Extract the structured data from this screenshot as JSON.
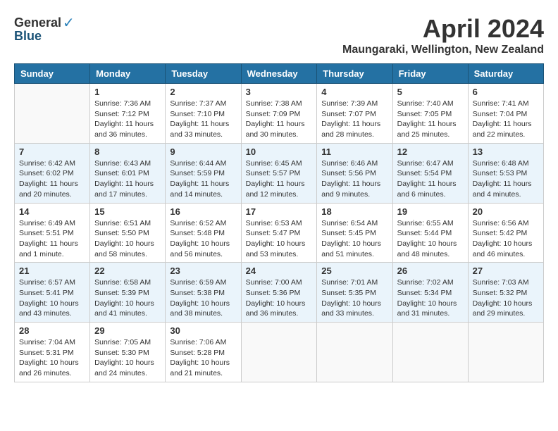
{
  "header": {
    "logo_general": "General",
    "logo_blue": "Blue",
    "month_title": "April 2024",
    "location": "Maungaraki, Wellington, New Zealand"
  },
  "days_of_week": [
    "Sunday",
    "Monday",
    "Tuesday",
    "Wednesday",
    "Thursday",
    "Friday",
    "Saturday"
  ],
  "weeks": [
    [
      {
        "day": "",
        "sunrise": "",
        "sunset": "",
        "daylight": ""
      },
      {
        "day": "1",
        "sunrise": "Sunrise: 7:36 AM",
        "sunset": "Sunset: 7:12 PM",
        "daylight": "Daylight: 11 hours and 36 minutes."
      },
      {
        "day": "2",
        "sunrise": "Sunrise: 7:37 AM",
        "sunset": "Sunset: 7:10 PM",
        "daylight": "Daylight: 11 hours and 33 minutes."
      },
      {
        "day": "3",
        "sunrise": "Sunrise: 7:38 AM",
        "sunset": "Sunset: 7:09 PM",
        "daylight": "Daylight: 11 hours and 30 minutes."
      },
      {
        "day": "4",
        "sunrise": "Sunrise: 7:39 AM",
        "sunset": "Sunset: 7:07 PM",
        "daylight": "Daylight: 11 hours and 28 minutes."
      },
      {
        "day": "5",
        "sunrise": "Sunrise: 7:40 AM",
        "sunset": "Sunset: 7:05 PM",
        "daylight": "Daylight: 11 hours and 25 minutes."
      },
      {
        "day": "6",
        "sunrise": "Sunrise: 7:41 AM",
        "sunset": "Sunset: 7:04 PM",
        "daylight": "Daylight: 11 hours and 22 minutes."
      }
    ],
    [
      {
        "day": "7",
        "sunrise": "Sunrise: 6:42 AM",
        "sunset": "Sunset: 6:02 PM",
        "daylight": "Daylight: 11 hours and 20 minutes."
      },
      {
        "day": "8",
        "sunrise": "Sunrise: 6:43 AM",
        "sunset": "Sunset: 6:01 PM",
        "daylight": "Daylight: 11 hours and 17 minutes."
      },
      {
        "day": "9",
        "sunrise": "Sunrise: 6:44 AM",
        "sunset": "Sunset: 5:59 PM",
        "daylight": "Daylight: 11 hours and 14 minutes."
      },
      {
        "day": "10",
        "sunrise": "Sunrise: 6:45 AM",
        "sunset": "Sunset: 5:57 PM",
        "daylight": "Daylight: 11 hours and 12 minutes."
      },
      {
        "day": "11",
        "sunrise": "Sunrise: 6:46 AM",
        "sunset": "Sunset: 5:56 PM",
        "daylight": "Daylight: 11 hours and 9 minutes."
      },
      {
        "day": "12",
        "sunrise": "Sunrise: 6:47 AM",
        "sunset": "Sunset: 5:54 PM",
        "daylight": "Daylight: 11 hours and 6 minutes."
      },
      {
        "day": "13",
        "sunrise": "Sunrise: 6:48 AM",
        "sunset": "Sunset: 5:53 PM",
        "daylight": "Daylight: 11 hours and 4 minutes."
      }
    ],
    [
      {
        "day": "14",
        "sunrise": "Sunrise: 6:49 AM",
        "sunset": "Sunset: 5:51 PM",
        "daylight": "Daylight: 11 hours and 1 minute."
      },
      {
        "day": "15",
        "sunrise": "Sunrise: 6:51 AM",
        "sunset": "Sunset: 5:50 PM",
        "daylight": "Daylight: 10 hours and 58 minutes."
      },
      {
        "day": "16",
        "sunrise": "Sunrise: 6:52 AM",
        "sunset": "Sunset: 5:48 PM",
        "daylight": "Daylight: 10 hours and 56 minutes."
      },
      {
        "day": "17",
        "sunrise": "Sunrise: 6:53 AM",
        "sunset": "Sunset: 5:47 PM",
        "daylight": "Daylight: 10 hours and 53 minutes."
      },
      {
        "day": "18",
        "sunrise": "Sunrise: 6:54 AM",
        "sunset": "Sunset: 5:45 PM",
        "daylight": "Daylight: 10 hours and 51 minutes."
      },
      {
        "day": "19",
        "sunrise": "Sunrise: 6:55 AM",
        "sunset": "Sunset: 5:44 PM",
        "daylight": "Daylight: 10 hours and 48 minutes."
      },
      {
        "day": "20",
        "sunrise": "Sunrise: 6:56 AM",
        "sunset": "Sunset: 5:42 PM",
        "daylight": "Daylight: 10 hours and 46 minutes."
      }
    ],
    [
      {
        "day": "21",
        "sunrise": "Sunrise: 6:57 AM",
        "sunset": "Sunset: 5:41 PM",
        "daylight": "Daylight: 10 hours and 43 minutes."
      },
      {
        "day": "22",
        "sunrise": "Sunrise: 6:58 AM",
        "sunset": "Sunset: 5:39 PM",
        "daylight": "Daylight: 10 hours and 41 minutes."
      },
      {
        "day": "23",
        "sunrise": "Sunrise: 6:59 AM",
        "sunset": "Sunset: 5:38 PM",
        "daylight": "Daylight: 10 hours and 38 minutes."
      },
      {
        "day": "24",
        "sunrise": "Sunrise: 7:00 AM",
        "sunset": "Sunset: 5:36 PM",
        "daylight": "Daylight: 10 hours and 36 minutes."
      },
      {
        "day": "25",
        "sunrise": "Sunrise: 7:01 AM",
        "sunset": "Sunset: 5:35 PM",
        "daylight": "Daylight: 10 hours and 33 minutes."
      },
      {
        "day": "26",
        "sunrise": "Sunrise: 7:02 AM",
        "sunset": "Sunset: 5:34 PM",
        "daylight": "Daylight: 10 hours and 31 minutes."
      },
      {
        "day": "27",
        "sunrise": "Sunrise: 7:03 AM",
        "sunset": "Sunset: 5:32 PM",
        "daylight": "Daylight: 10 hours and 29 minutes."
      }
    ],
    [
      {
        "day": "28",
        "sunrise": "Sunrise: 7:04 AM",
        "sunset": "Sunset: 5:31 PM",
        "daylight": "Daylight: 10 hours and 26 minutes."
      },
      {
        "day": "29",
        "sunrise": "Sunrise: 7:05 AM",
        "sunset": "Sunset: 5:30 PM",
        "daylight": "Daylight: 10 hours and 24 minutes."
      },
      {
        "day": "30",
        "sunrise": "Sunrise: 7:06 AM",
        "sunset": "Sunset: 5:28 PM",
        "daylight": "Daylight: 10 hours and 21 minutes."
      },
      {
        "day": "",
        "sunrise": "",
        "sunset": "",
        "daylight": ""
      },
      {
        "day": "",
        "sunrise": "",
        "sunset": "",
        "daylight": ""
      },
      {
        "day": "",
        "sunrise": "",
        "sunset": "",
        "daylight": ""
      },
      {
        "day": "",
        "sunrise": "",
        "sunset": "",
        "daylight": ""
      }
    ]
  ]
}
